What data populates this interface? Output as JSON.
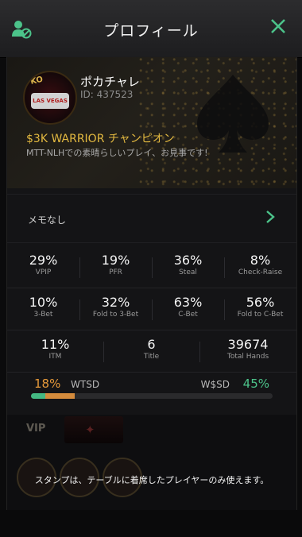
{
  "header": {
    "title": "プロフィール"
  },
  "profile": {
    "name": "ポカチャレ",
    "id_text": "ID: 437523",
    "avatar_tag": "PKO",
    "avatar_sign": "LAS VEGAS",
    "achievement": "$3K WARRIOR チャンピオン",
    "description": "MTT-NLHでの素晴らしいプレイ、お見事です!"
  },
  "memo": {
    "label": "メモなし"
  },
  "stats": {
    "row1": [
      {
        "value": "29%",
        "label": "VPIP"
      },
      {
        "value": "19%",
        "label": "PFR"
      },
      {
        "value": "36%",
        "label": "Steal"
      },
      {
        "value": "8%",
        "label": "Check-Raise"
      }
    ],
    "row2": [
      {
        "value": "10%",
        "label": "3-Bet"
      },
      {
        "value": "32%",
        "label": "Fold to 3-Bet"
      },
      {
        "value": "63%",
        "label": "C-Bet"
      },
      {
        "value": "56%",
        "label": "Fold to C-Bet"
      }
    ],
    "row3": [
      {
        "value": "11%",
        "label": "ITM"
      },
      {
        "value": "6",
        "label": "Title"
      },
      {
        "value": "39674",
        "label": "Total Hands"
      }
    ]
  },
  "showdown": {
    "wtsd_value": "18%",
    "wtsd_label": "WTSD",
    "wsd_label": "W$SD",
    "wsd_value": "45%",
    "wtsd_fraction": 0.18,
    "wsd_fraction": 0.45,
    "colors": {
      "wtsd": "#e79a3a",
      "wsd": "#4cc38a"
    }
  },
  "vip": {
    "label": "VIP",
    "stamp_note": "スタンプは、テーブルに着席したプレイヤーのみ使えます。"
  },
  "colors": {
    "accent_green": "#4cc38a",
    "gold": "#e3b940"
  },
  "icons": {
    "left": "user-block-icon",
    "right": "close-icon",
    "memo": "chevron-right-icon"
  }
}
